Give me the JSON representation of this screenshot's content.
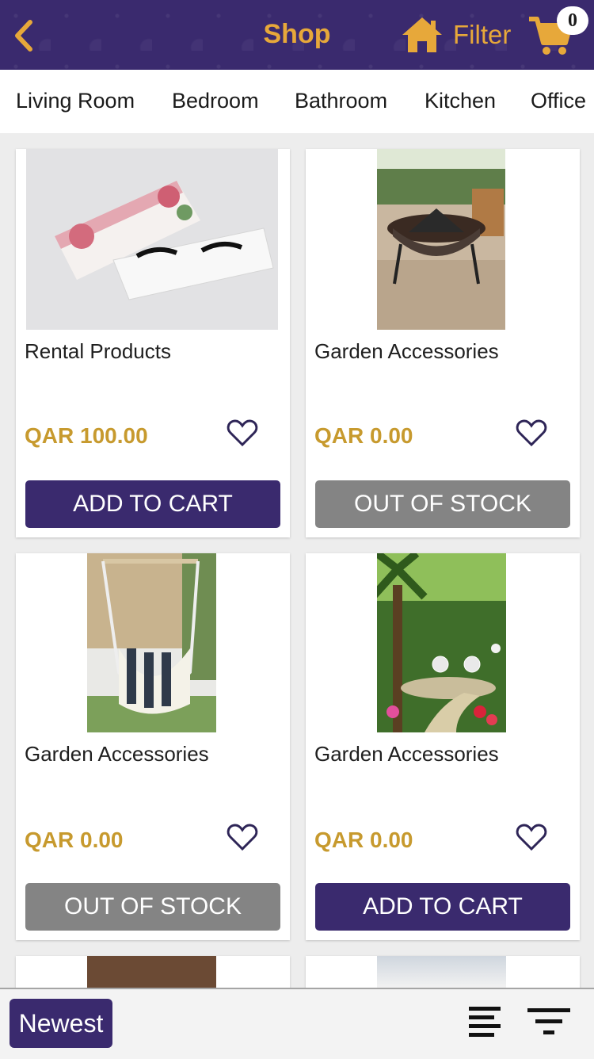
{
  "header": {
    "title": "Shop",
    "filter_label": "Filter",
    "cart_count": "0",
    "icons": {
      "back": "back-chevron-icon",
      "home": "home-icon",
      "cart": "cart-icon"
    }
  },
  "categories": [
    "Living Room",
    "Bedroom",
    "Bathroom",
    "Kitchen",
    "Office"
  ],
  "products": [
    {
      "name": "Rental Products",
      "price": "QAR 100.00",
      "button": "ADD TO CART",
      "status": "in-stock",
      "image": "eyelash-product-photo"
    },
    {
      "name": "Garden Accessories",
      "price": "QAR 0.00",
      "button": "OUT OF STOCK",
      "status": "out-of-stock",
      "image": "fire-pit-photo"
    },
    {
      "name": "Garden Accessories",
      "price": "QAR 0.00",
      "button": "OUT OF STOCK",
      "status": "out-of-stock",
      "image": "hammock-chair-photo"
    },
    {
      "name": "Garden Accessories",
      "price": "QAR 0.00",
      "button": "ADD TO CART",
      "status": "in-stock",
      "image": "garden-path-photo"
    }
  ],
  "bottom_bar": {
    "sort_label": "Newest",
    "icons": {
      "align": "align-lines-icon",
      "filter": "filter-lines-icon"
    }
  },
  "colors": {
    "brand_purple": "#3a2a6e",
    "accent_gold": "#e7a83a",
    "price_gold": "#c79a2e",
    "disabled_gray": "#848484"
  }
}
